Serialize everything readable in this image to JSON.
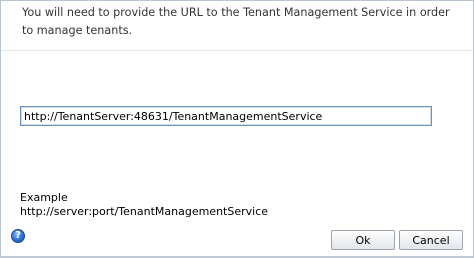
{
  "dialog": {
    "message": "You will need to provide the URL to the Tenant Management Service in order to manage tenants.",
    "url_input": {
      "value": "http://TenantServer:48631/TenantManagementService"
    },
    "example": {
      "label": "Example",
      "value": "http://server:port/TenantManagementService"
    },
    "help_icon": {
      "glyph": "?",
      "icon": "help-icon"
    },
    "buttons": {
      "ok_label": "Ok",
      "cancel_label": "Cancel"
    }
  }
}
